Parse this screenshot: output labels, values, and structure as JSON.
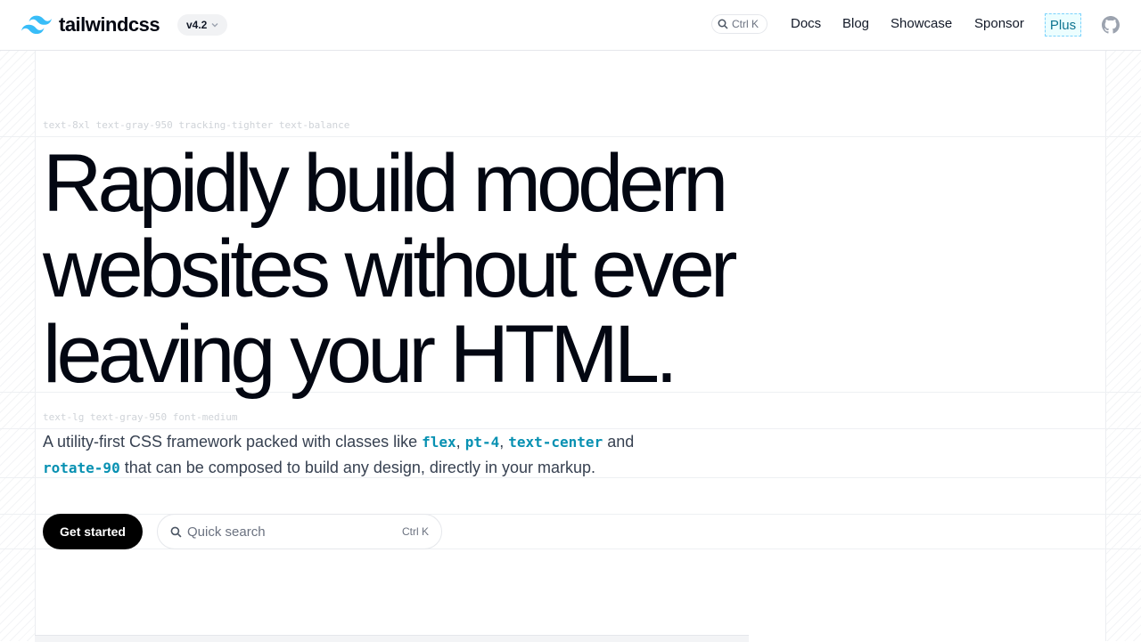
{
  "header": {
    "brand": "tailwindcss",
    "version": "v4.2",
    "search_shortcut": "Ctrl K",
    "nav": [
      "Docs",
      "Blog",
      "Showcase",
      "Sponsor"
    ],
    "plus": "Plus"
  },
  "hero": {
    "headline_label": "text-8xl text-gray-950 tracking-tighter text-balance",
    "headline_lines": [
      "Rapidly build modern",
      "websites without ever",
      "leaving your HTML."
    ],
    "sub_label": "text-lg text-gray-950 font-medium",
    "sub": {
      "pre": "A utility-first CSS framework packed with classes like ",
      "codes": [
        "flex",
        "pt-4",
        "text-center",
        "rotate-90"
      ],
      "sep1": ", ",
      "sep2": ", ",
      "and": " and",
      "post": " that can be composed to build any design, directly in your markup."
    },
    "cta_label": "Get started",
    "search_placeholder": "Quick search",
    "search_shortcut": "Ctrl K"
  },
  "colors": {
    "accent": "#0891b2",
    "logo": "#38bdf8",
    "text": "#030712"
  }
}
